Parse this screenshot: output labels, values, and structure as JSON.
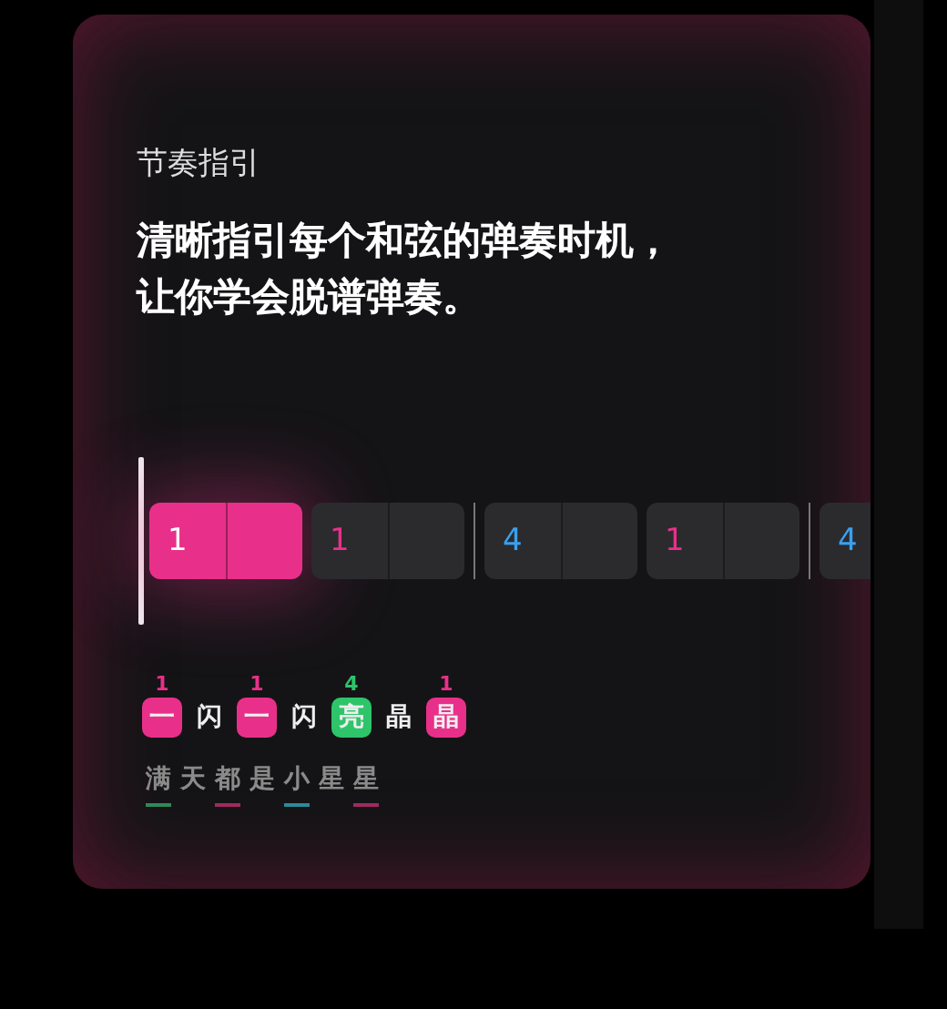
{
  "card": {
    "label": "节奏指引",
    "headline_lines": [
      "清晰指引每个和弦的弹奏时机，",
      "让你学会脱谱弹奏。"
    ]
  },
  "bars": [
    {
      "chord": "1",
      "color": "#e8308a",
      "active": true,
      "divider_before": false
    },
    {
      "chord": "1",
      "color": "#e8308a",
      "active": false,
      "divider_before": false
    },
    {
      "chord": "4",
      "color": "#3aa0f0",
      "active": false,
      "divider_before": true
    },
    {
      "chord": "1",
      "color": "#e8308a",
      "active": false,
      "divider_before": false
    },
    {
      "chord": "4",
      "color": "#3aa0f0",
      "active": false,
      "divider_before": true
    }
  ],
  "lyrics": [
    {
      "char": "一",
      "chord": "1",
      "color": "#e8308a",
      "highlighted": true
    },
    {
      "char": "闪",
      "highlighted": false
    },
    {
      "char": "一",
      "chord": "1",
      "color": "#e8308a",
      "highlighted": true
    },
    {
      "char": "闪",
      "highlighted": false
    },
    {
      "char": "亮",
      "chord": "4",
      "color": "#2ec46a",
      "highlighted": true
    },
    {
      "char": "晶",
      "highlighted": false
    },
    {
      "char": "晶",
      "chord": "1",
      "color": "#e8308a",
      "highlighted": true
    }
  ],
  "next_lyrics": [
    {
      "char": "满",
      "color": "#2e8a5a"
    },
    {
      "char": "天"
    },
    {
      "char": "都",
      "color": "#a02a60"
    },
    {
      "char": "是"
    },
    {
      "char": "小",
      "color": "#2a8a9a"
    },
    {
      "char": "星"
    },
    {
      "char": "星",
      "color": "#a02a60"
    }
  ]
}
